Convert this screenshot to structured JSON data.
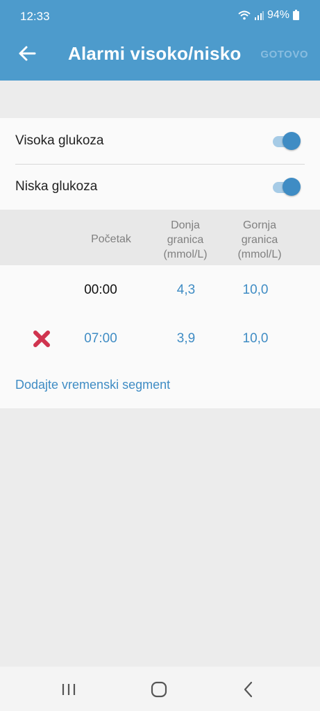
{
  "status_bar": {
    "time": "12:33",
    "battery": "94%"
  },
  "app_bar": {
    "title": "Alarmi visoko/nisko",
    "done_label": "GOTOVO"
  },
  "alarms": [
    {
      "label": "Visoka glukoza",
      "enabled": true
    },
    {
      "label": "Niska glukoza",
      "enabled": true
    }
  ],
  "table": {
    "headers": {
      "start": "Početak",
      "lower_1": "Donja",
      "lower_2": "granica",
      "lower_3": "(mmol/L)",
      "upper_1": "Gornja",
      "upper_2": "granica",
      "upper_3": "(mmol/L)"
    },
    "rows": [
      {
        "start": "00:00",
        "lower": "4,3",
        "upper": "10,0"
      },
      {
        "start": "07:00",
        "lower": "3,9",
        "upper": "10,0"
      }
    ]
  },
  "add_segment_label": "Dodajte vremenski segment",
  "colors": {
    "app_bar": "#4d9bcc",
    "accent": "#3f8cc4",
    "delete": "#d0344f"
  },
  "icons": [
    "arrow-left-icon",
    "wifi-icon",
    "signal-icon",
    "battery-icon",
    "delete-x-icon",
    "recent-apps-icon",
    "home-icon",
    "back-nav-icon"
  ]
}
